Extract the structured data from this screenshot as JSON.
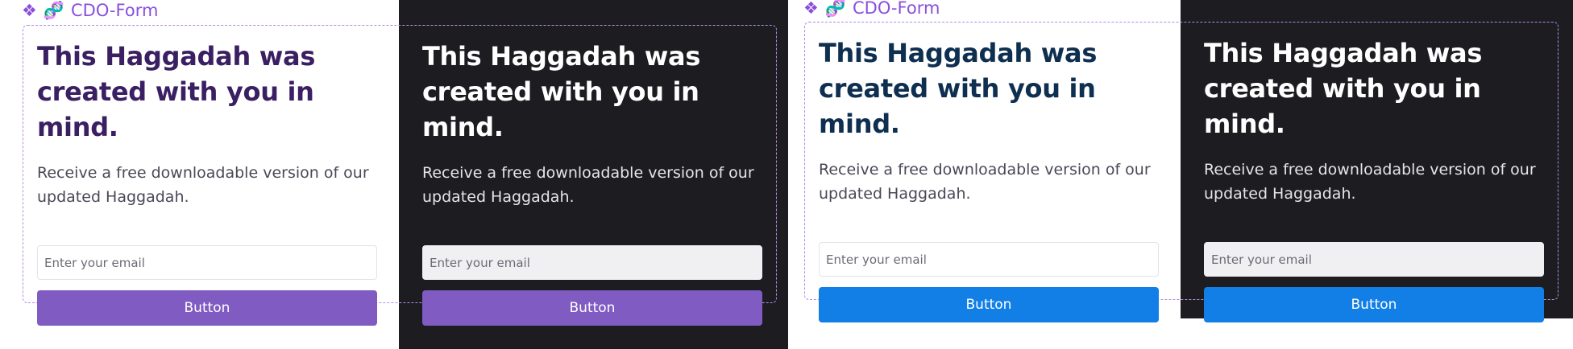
{
  "theme": {
    "accent_purple": "#7f5bc2",
    "accent_blue": "#127fe6",
    "dark_background": "#1c1c21",
    "label_color": "#8a4fdc"
  },
  "variants": [
    {
      "component_label": "CDO-Form",
      "icons": [
        "component-diamond-icon",
        "dna-icon"
      ],
      "panels": [
        {
          "mode": "light",
          "title": "This Haggadah was created with you in mind.",
          "description": "Receive a free downloadable version of our updated Haggadah.",
          "email_placeholder": "Enter your email",
          "button_label": "Button"
        },
        {
          "mode": "dark",
          "title": "This Haggadah was created with you in mind.",
          "description": "Receive a free downloadable version of our updated Haggadah.",
          "email_placeholder": "Enter your email",
          "button_label": "Button"
        }
      ]
    },
    {
      "component_label": "CDO-Form",
      "icons": [
        "component-diamond-icon",
        "dna-icon"
      ],
      "panels": [
        {
          "mode": "light",
          "title": "This Haggadah was created with you in mind.",
          "description": "Receive a free downloadable version of our updated Haggadah.",
          "email_placeholder": "Enter your email",
          "button_label": "Button"
        },
        {
          "mode": "dark",
          "title": "This Haggadah was created with you in mind.",
          "description": "Receive a free downloadable version of our updated Haggadah.",
          "email_placeholder": "Enter your email",
          "button_label": "Button"
        }
      ]
    }
  ]
}
